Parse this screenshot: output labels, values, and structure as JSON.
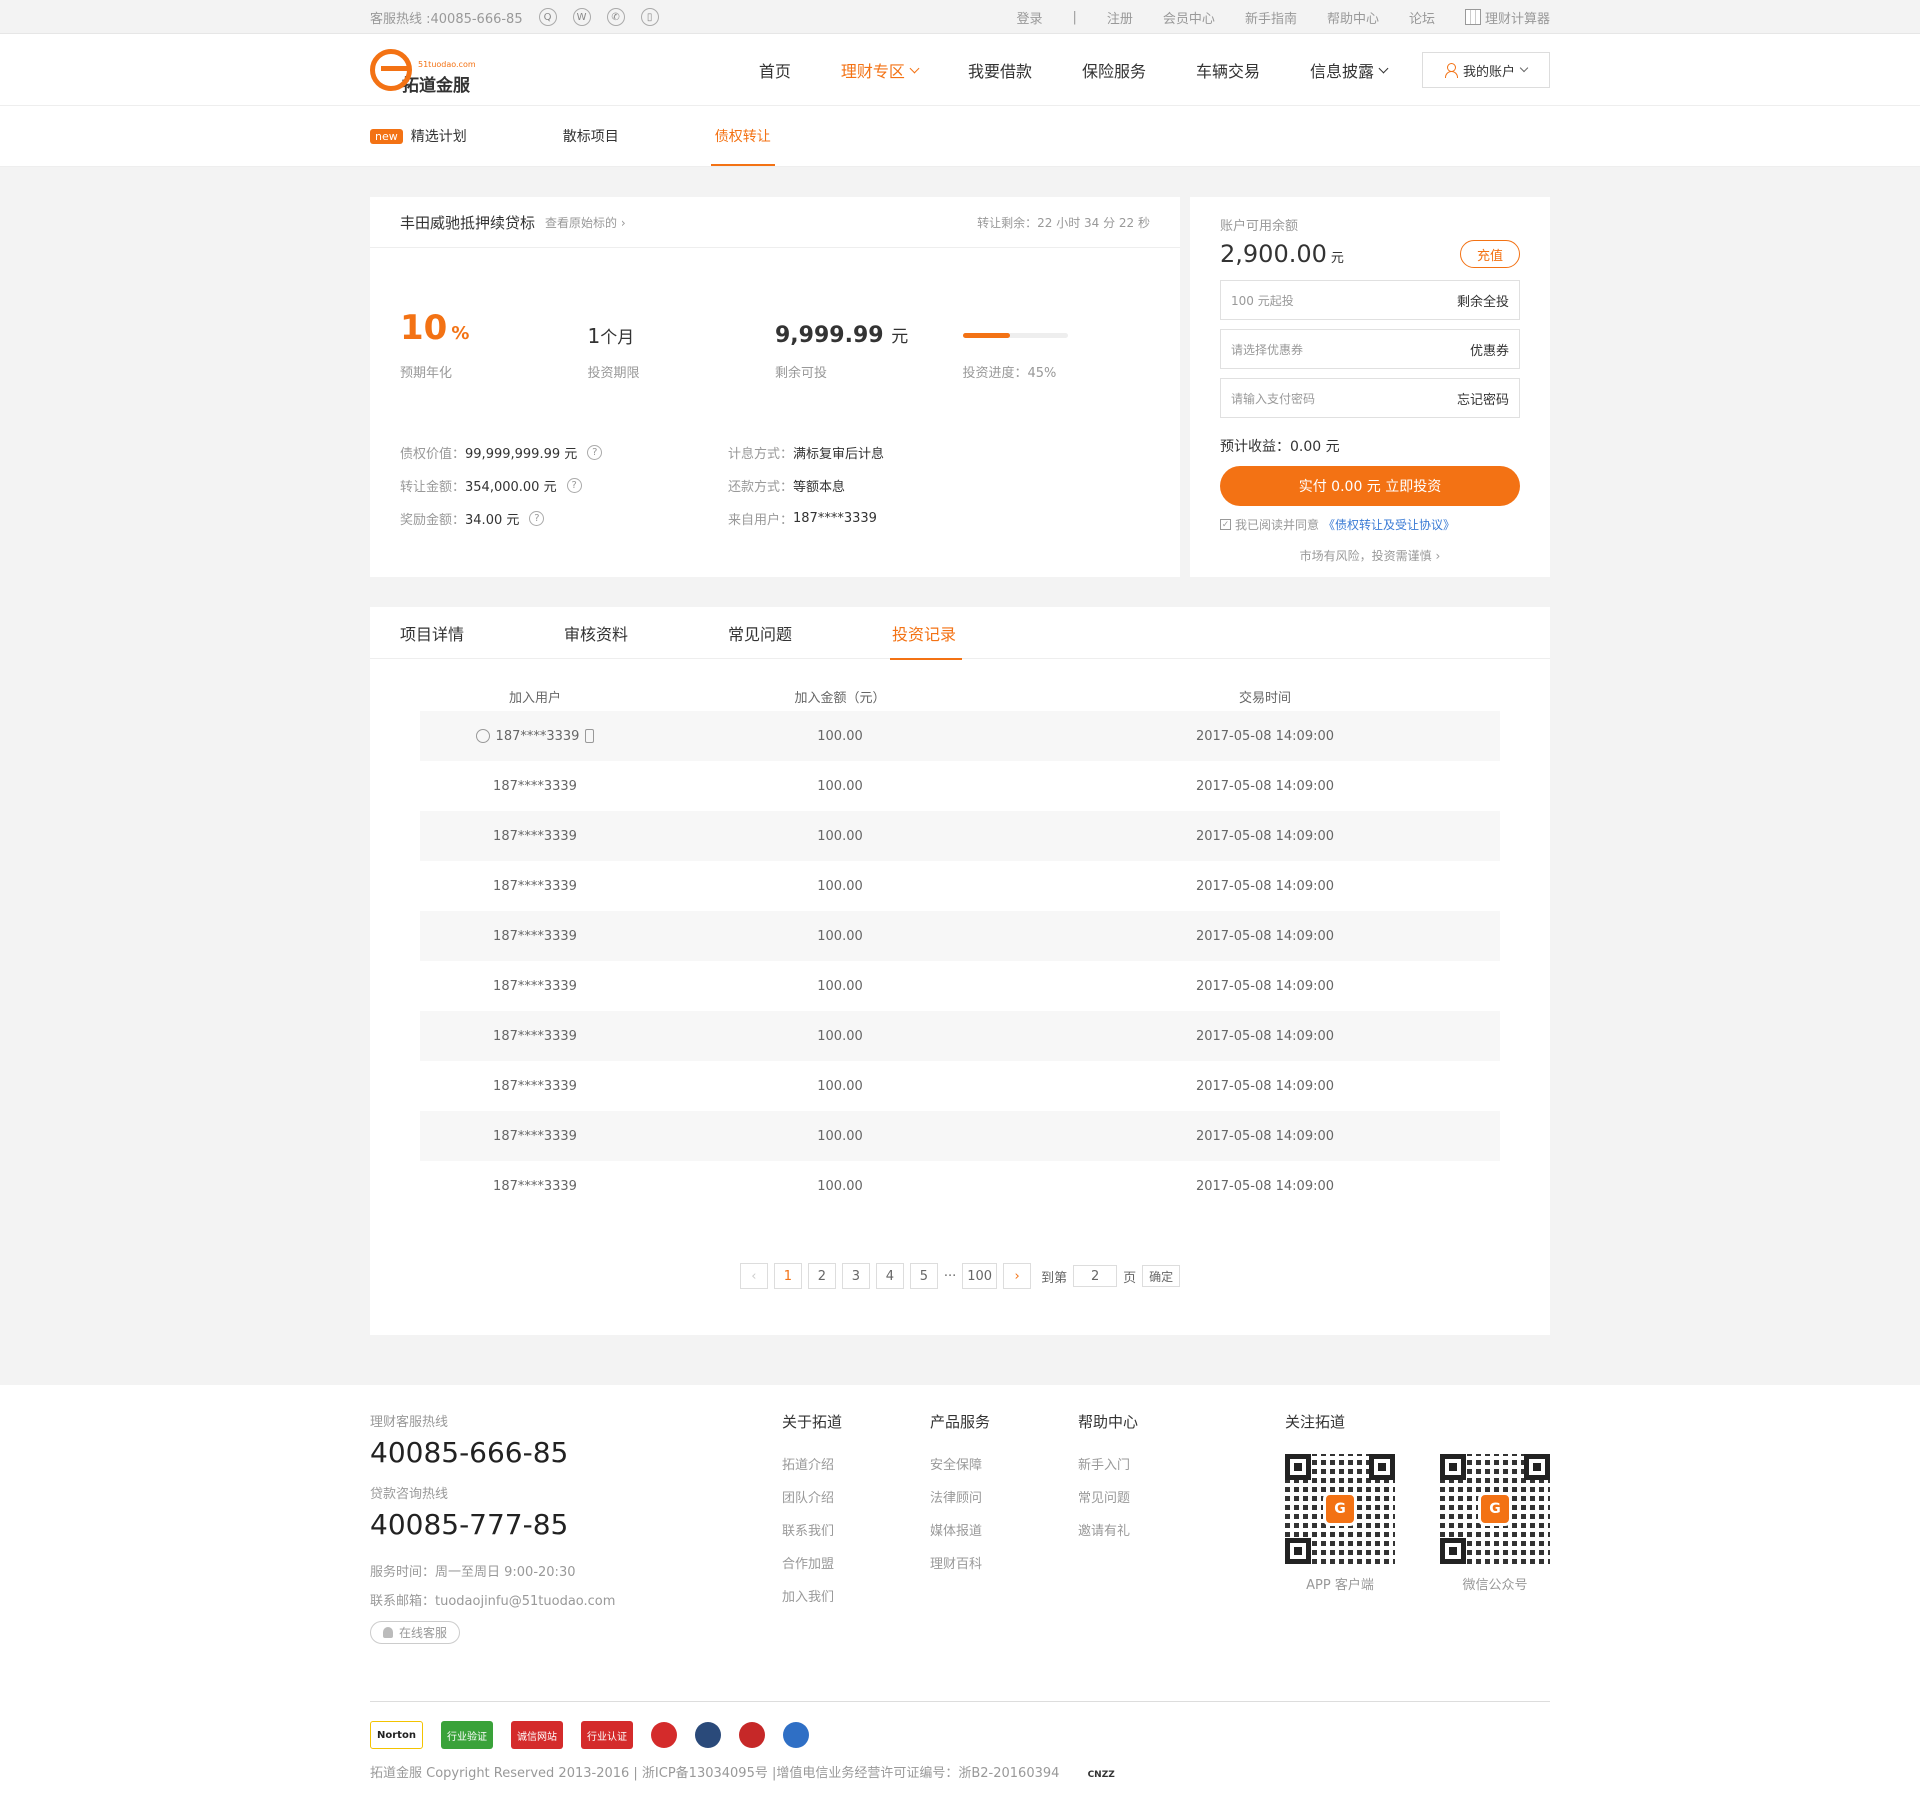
{
  "topbar": {
    "hotline": "客服热线 :40085-666-85",
    "links": [
      "登录",
      "注册",
      "会员中心",
      "新手指南",
      "帮助中心",
      "论坛"
    ],
    "calculator": "理财计算器"
  },
  "logo": {
    "text": "拓道金服",
    "sub": "51tuodao.com"
  },
  "nav": {
    "items": [
      "首页",
      "理财专区",
      "我要借款",
      "保险服务",
      "车辆交易",
      "信息披露"
    ],
    "account": "我的账户"
  },
  "subnav": {
    "new_badge": "new",
    "items": [
      "精选计划",
      "散标项目",
      "债权转让"
    ]
  },
  "detail": {
    "title": "丰田威驰抵押续贷标",
    "origin_link": "查看原始标的",
    "timer": "转让剩余：22 小时 34 分 22 秒",
    "rate": "10",
    "rate_unit": "%",
    "rate_label": "预期年化",
    "term_num": "1",
    "term_unit": "个月",
    "term_label": "投资期限",
    "remain": "9,999.99",
    "remain_unit": "元",
    "remain_label": "剩余可投",
    "progress_percent": 45,
    "progress_label": "投资进度：45%",
    "info_left": [
      {
        "label": "债权价值：",
        "value": "99,999,999.99 元"
      },
      {
        "label": "转让金额：",
        "value": "354,000.00 元"
      },
      {
        "label": "奖励金额：",
        "value": "34.00 元"
      }
    ],
    "info_right": [
      {
        "label": "计息方式：",
        "value": "满标复审后计息"
      },
      {
        "label": "还款方式：",
        "value": "等额本息"
      },
      {
        "label": "来自用户：",
        "value": "187****3339"
      }
    ]
  },
  "invest": {
    "balance_label": "账户可用余额",
    "balance": "2,900.00",
    "balance_unit": "元",
    "charge": "充值",
    "field1_placeholder": "100 元起投",
    "field1_action": "剩余全投",
    "field2_placeholder": "请选择优惠券",
    "field2_action": "优惠券",
    "field3_placeholder": "请输入支付密码",
    "field3_action": "忘记密码",
    "expect": "预计收益：0.00 元",
    "button": "实付 0.00 元  立即投资",
    "agree_text": "我已阅读并同意",
    "agree_link": "《债权转让及受让协议》",
    "risk": "市场有风险，投资需谨慎"
  },
  "tabs": [
    "项目详情",
    "审核资料",
    "常见问题",
    "投资记录"
  ],
  "records": {
    "headers": [
      "加入用户",
      "加入金额（元）",
      "交易时间"
    ],
    "rows": [
      {
        "user": "187****3339",
        "amount": "100.00",
        "time": "2017-05-08 14:09:00"
      },
      {
        "user": "187****3339",
        "amount": "100.00",
        "time": "2017-05-08 14:09:00"
      },
      {
        "user": "187****3339",
        "amount": "100.00",
        "time": "2017-05-08 14:09:00"
      },
      {
        "user": "187****3339",
        "amount": "100.00",
        "time": "2017-05-08 14:09:00"
      },
      {
        "user": "187****3339",
        "amount": "100.00",
        "time": "2017-05-08 14:09:00"
      },
      {
        "user": "187****3339",
        "amount": "100.00",
        "time": "2017-05-08 14:09:00"
      },
      {
        "user": "187****3339",
        "amount": "100.00",
        "time": "2017-05-08 14:09:00"
      },
      {
        "user": "187****3339",
        "amount": "100.00",
        "time": "2017-05-08 14:09:00"
      },
      {
        "user": "187****3339",
        "amount": "100.00",
        "time": "2017-05-08 14:09:00"
      },
      {
        "user": "187****3339",
        "amount": "100.00",
        "time": "2017-05-08 14:09:00"
      }
    ]
  },
  "pager": {
    "pages": [
      "1",
      "2",
      "3",
      "4",
      "5"
    ],
    "ellipsis": "···",
    "last": "100",
    "goto": "到第",
    "goto_value": "2",
    "page_unit": "页",
    "confirm": "确定"
  },
  "footer": {
    "hotline_label": "理财客服热线",
    "hotline": "40085-666-85",
    "loan_label": "贷款咨询热线",
    "loan": "40085-777-85",
    "service_time": "服务时间：周一至周日  9:00-20:30",
    "email": "联系邮箱：tuodaojinfu@51tuodao.com",
    "online": "在线客服",
    "col1": {
      "title": "关于拓道",
      "items": [
        "拓道介绍",
        "团队介绍",
        "联系我们",
        "合作加盟",
        "加入我们"
      ]
    },
    "col2": {
      "title": "产品服务",
      "items": [
        "安全保障",
        "法律顾问",
        "媒体报道",
        "理财百科"
      ]
    },
    "col3": {
      "title": "帮助中心",
      "items": [
        "新手入门",
        "常见问题",
        "邀请有礼"
      ]
    },
    "follow": "关注拓道",
    "qr1": "APP 客户端",
    "qr2": "微信公众号",
    "badges": [
      "Norton",
      "行业验证",
      "诚信网站",
      "行业认证"
    ],
    "copyright": "拓道金服 Copyright Reserved 2013-2016 | 浙ICP备13034095号 |增值电信业务经营许可证编号：浙B2-20160394",
    "cnzz": "CNZZ"
  }
}
